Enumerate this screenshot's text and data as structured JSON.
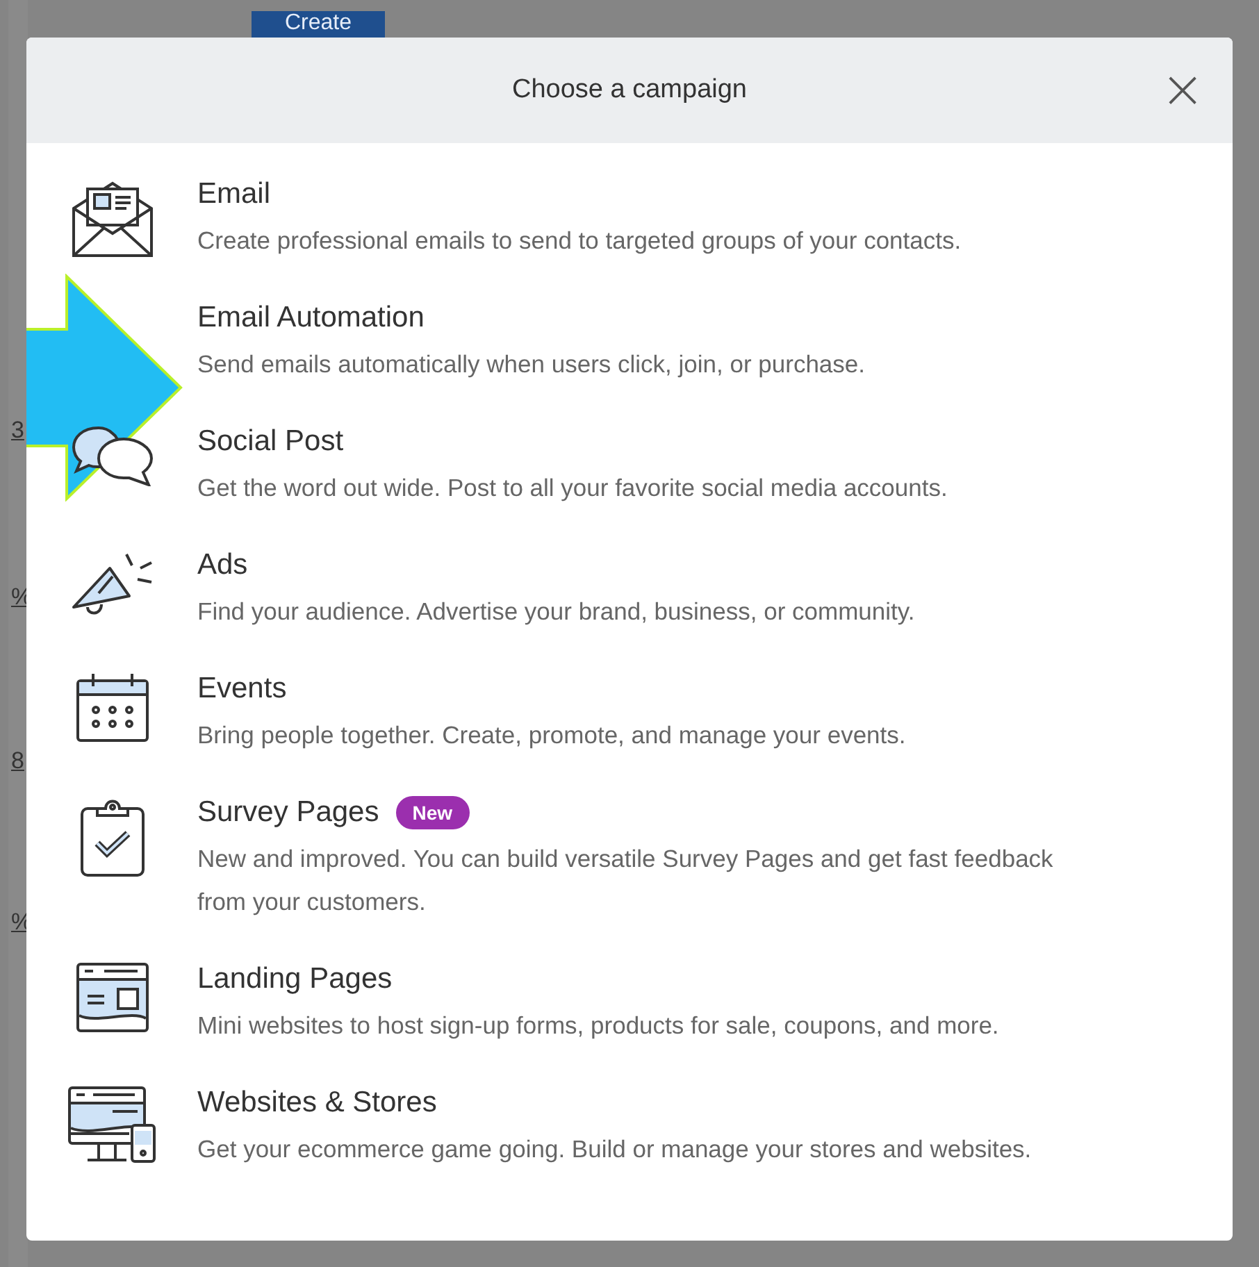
{
  "background": {
    "button": "Create",
    "edge_marks": [
      "3",
      "%",
      "8",
      "%"
    ]
  },
  "dialog": {
    "title": "Choose a campaign",
    "close": "×",
    "items": [
      {
        "title": "Email",
        "description": "Create professional emails to send to targeted groups of your contacts.",
        "pointed": false
      },
      {
        "title": "Email Automation",
        "description": "Send emails automatically when users click, join, or purchase.",
        "pointed": true
      },
      {
        "title": "Social Post",
        "description": "Get the word out wide. Post to all your favorite social media accounts.",
        "pointed": false
      },
      {
        "title": "Ads",
        "description": "Find your audience. Advertise your brand, business, or community.",
        "pointed": false
      },
      {
        "title": "Events",
        "description": "Bring people together. Create, promote, and manage your events.",
        "pointed": false
      },
      {
        "title": "Survey Pages",
        "badge": "New",
        "description": "New and improved. You can build versatile Survey Pages and get fast feedback from your customers.",
        "pointed": false
      },
      {
        "title": "Landing Pages",
        "description": "Mini websites to host sign-up forms, products for sale, coupons, and more.",
        "pointed": false
      },
      {
        "title": "Websites & Stores",
        "description": "Get your ecommerce game going. Build or manage your stores and websites.",
        "pointed": false
      }
    ]
  }
}
